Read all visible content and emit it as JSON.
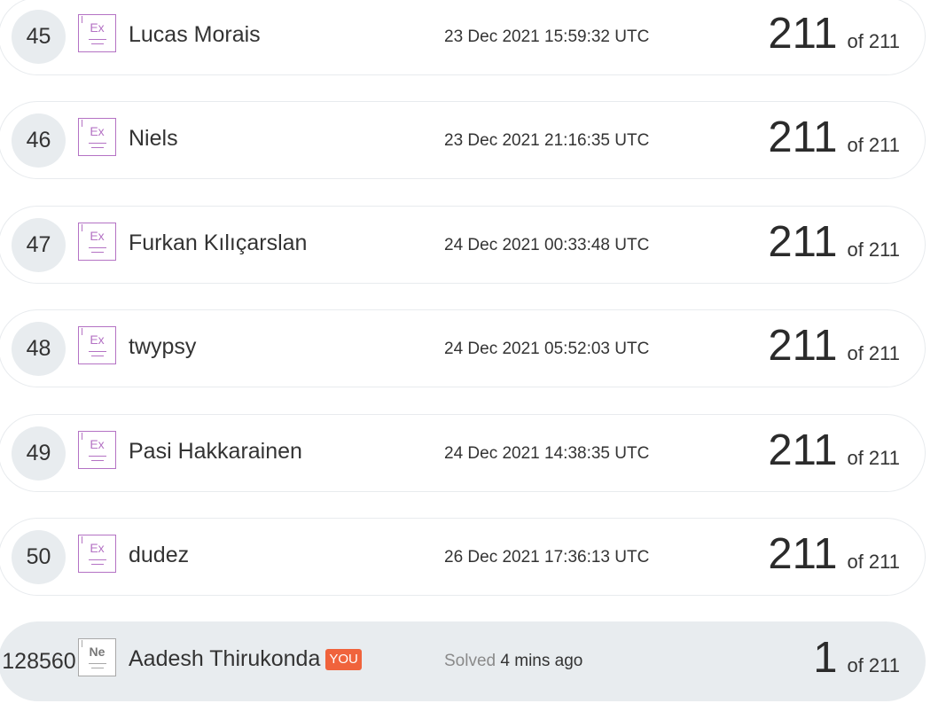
{
  "rows": [
    {
      "rank": "45",
      "badge_symbol": "Ex",
      "name": "Lucas Morais",
      "time": "23 Dec 2021 15:59:32 UTC",
      "score": "211",
      "total": "of 211"
    },
    {
      "rank": "46",
      "badge_symbol": "Ex",
      "name": "Niels",
      "time": "23 Dec 2021 21:16:35 UTC",
      "score": "211",
      "total": "of 211"
    },
    {
      "rank": "47",
      "badge_symbol": "Ex",
      "name": "Furkan Kılıçarslan",
      "time": "24 Dec 2021 00:33:48 UTC",
      "score": "211",
      "total": "of 211"
    },
    {
      "rank": "48",
      "badge_symbol": "Ex",
      "name": "twypsy",
      "time": "24 Dec 2021 05:52:03 UTC",
      "score": "211",
      "total": "of 211"
    },
    {
      "rank": "49",
      "badge_symbol": "Ex",
      "name": "Pasi Hakkarainen",
      "time": "24 Dec 2021 14:38:35 UTC",
      "score": "211",
      "total": "of 211"
    },
    {
      "rank": "50",
      "badge_symbol": "Ex",
      "name": "dudez",
      "time": "26 Dec 2021 17:36:13 UTC",
      "score": "211",
      "total": "of 211"
    }
  ],
  "you_row": {
    "rank": "128560",
    "badge_symbol": "Ne",
    "name": "Aadesh Thirukonda",
    "you_label": "YOU",
    "solved_label": "Solved",
    "solved_time": "4 mins ago",
    "score": "1",
    "total": "of 211"
  },
  "colors": {
    "badge_purple": "#b472c4",
    "you_badge": "#f0633c",
    "highlight_row": "#e8ecef"
  },
  "icons": {
    "element_badge": "element-badge-icon"
  }
}
